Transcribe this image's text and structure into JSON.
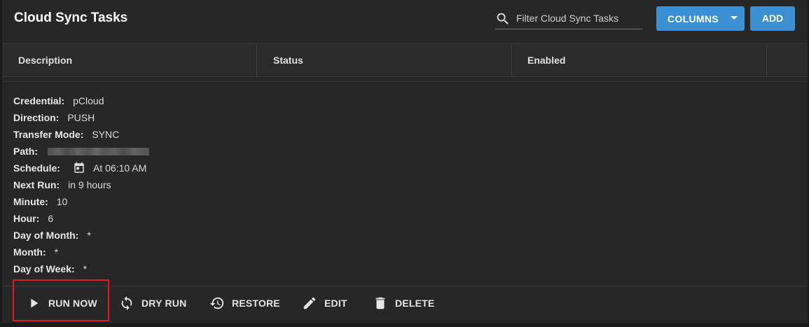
{
  "header": {
    "title": "Cloud Sync Tasks",
    "search_placeholder": "Filter Cloud Sync Tasks",
    "search_value": "",
    "columns_label": "COLUMNS",
    "add_label": "ADD"
  },
  "table": {
    "columns": [
      "Description",
      "Status",
      "Enabled"
    ]
  },
  "details": [
    {
      "key": "Credential:",
      "value": "pCloud"
    },
    {
      "key": "Direction:",
      "value": "PUSH"
    },
    {
      "key": "Transfer Mode:",
      "value": "SYNC"
    },
    {
      "key": "Path:",
      "value": ""
    },
    {
      "key": "Schedule:",
      "value": "At 06:10 AM"
    },
    {
      "key": "Next Run:",
      "value": "in 9 hours"
    },
    {
      "key": "Minute:",
      "value": "10"
    },
    {
      "key": "Hour:",
      "value": "6"
    },
    {
      "key": "Day of Month:",
      "value": "*"
    },
    {
      "key": "Month:",
      "value": "*"
    },
    {
      "key": "Day of Week:",
      "value": "*"
    }
  ],
  "actions": {
    "run_now": "RUN NOW",
    "dry_run": "DRY RUN",
    "restore": "RESTORE",
    "edit": "EDIT",
    "delete": "DELETE"
  },
  "colors": {
    "accent": "#3d8fd4",
    "highlight": "#e01b1b",
    "background": "#1b1b1b",
    "card": "#272727"
  },
  "icons": [
    "search-icon",
    "caret-down-icon",
    "calendar-icon",
    "play-icon",
    "sync-icon",
    "history-icon",
    "pencil-icon",
    "trash-icon"
  ]
}
